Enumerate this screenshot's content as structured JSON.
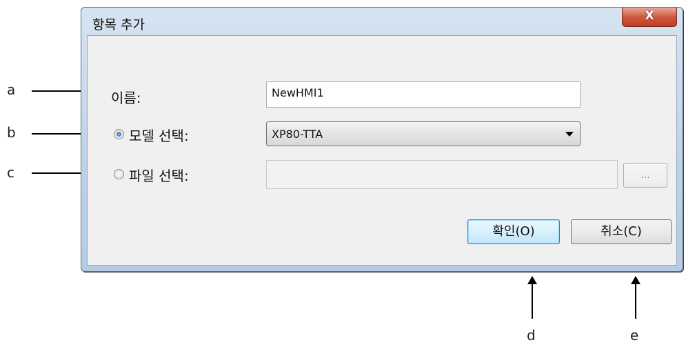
{
  "dialog": {
    "title": "항목 추가",
    "close_label": "X",
    "name_label": "이름:",
    "name_value": "NewHMI1",
    "model_label": "모델 선택:",
    "model_value": "XP80-TTA",
    "file_label": "파일 선택:",
    "file_value": "",
    "browse_label": "...",
    "ok_label": "확인(O)",
    "cancel_label": "취소(C)",
    "model_radio_checked": true,
    "file_radio_checked": false
  },
  "callouts": {
    "a": "a",
    "b": "b",
    "c": "c",
    "d": "d",
    "e": "e"
  }
}
